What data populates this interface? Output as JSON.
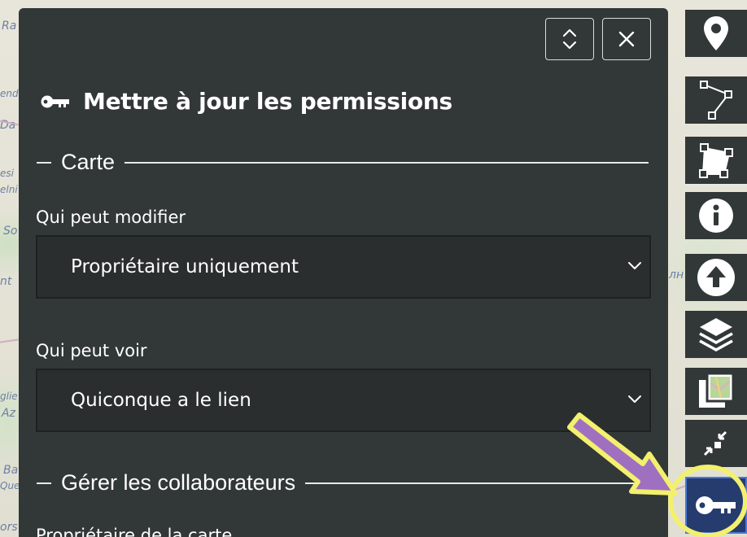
{
  "map": {
    "labels": [
      "Ra",
      "end",
      "Da",
      "esi",
      "elni",
      "So",
      "nt",
      "glie",
      "Az",
      "Ba",
      "Que",
      "ors",
      "лн"
    ]
  },
  "panel": {
    "title": "Mettre à jour les permissions",
    "title_icon": "key-icon",
    "expand_icon": "expand-collapse-icon",
    "close_icon": "close-icon",
    "section_map": "Carte",
    "edit_label": "Qui peut modifier",
    "edit_value": "Propriétaire uniquement",
    "view_label": "Qui peut voir",
    "view_value": "Quiconque a le lien",
    "section_collab": "Gérer les collaborateurs",
    "owner_label": "Propriétaire de la carte"
  },
  "toolbar": {
    "items": [
      {
        "name": "marker-icon"
      },
      {
        "name": "polyline-icon"
      },
      {
        "name": "polygon-icon"
      },
      {
        "name": "info-icon"
      },
      {
        "name": "upload-icon"
      },
      {
        "name": "layers-icon"
      },
      {
        "name": "tilelayer-icon"
      },
      {
        "name": "center-icon"
      },
      {
        "name": "key-icon"
      }
    ],
    "active": "key-icon"
  },
  "colors": {
    "panel_bg": "#323737",
    "select_bg": "#2a2e2e",
    "active_tool": "#263c6e",
    "annotation_fill": "#a070c0",
    "annotation_outline": "#f2f06e"
  }
}
